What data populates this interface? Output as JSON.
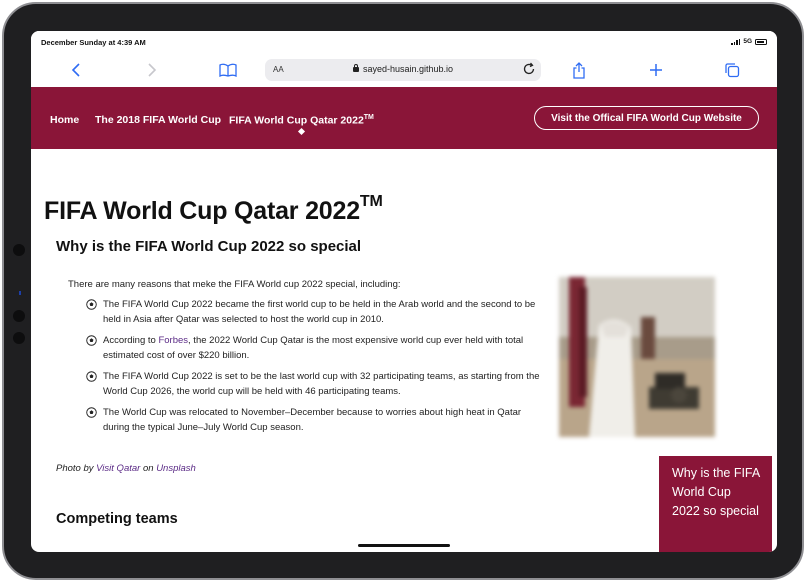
{
  "status": {
    "time": "December Sunday at 4:39 AM",
    "network": "5G"
  },
  "browser": {
    "text_size": "AA",
    "url": "sayed-husain.github.io"
  },
  "nav": {
    "links": [
      "Home",
      "The 2018 FIFA World Cup",
      "FIFA World Cup Qatar 2022"
    ],
    "active_superscript": "TM",
    "cta": "Visit the Offical FIFA World Cup Website"
  },
  "main": {
    "title": "FIFA World Cup Qatar 2022",
    "title_superscript": "TM",
    "section_title": "Why is the FIFA World Cup 2022 so special",
    "intro": "There are many reasons that meke the FIFA World cup 2022 special, including:",
    "reasons": [
      {
        "text": "The FIFA World Cup 2022 became the first world cup to be held in the Arab world and the second to be held in Asia after Qatar was selected to host the world cup in 2010."
      },
      {
        "before": "According to ",
        "link": "Forbes",
        "after": ", the 2022 World Cup Qatar is the most expensive world cup ever held with total estimated cost of over $220 billion."
      },
      {
        "text": "The FIFA World Cup 2022 is set to be the last world cup with 32 participating teams, as starting from the World Cup 2026, the world cup will be held with 46 participating teams."
      },
      {
        "text": "The World Cup was relocated to November–December because to worries about high heat in Qatar during the typical June–July World Cup season."
      }
    ],
    "credit": {
      "prefix": "Photo by ",
      "author": "Visit Qatar",
      "middle": " on ",
      "site": "Unsplash"
    },
    "subsection_title": "Competing teams"
  },
  "floating_box": {
    "text": "Why is the FIFA World Cup 2022 so special"
  },
  "colors": {
    "brand": "#8a1538",
    "link": "#5b2b86",
    "safari_blue": "#2f6cf3"
  }
}
